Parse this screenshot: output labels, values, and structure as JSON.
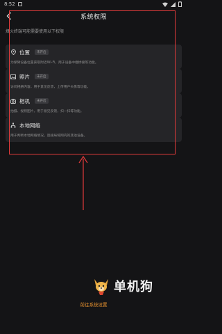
{
  "status_bar": {
    "time": "8:52"
  },
  "header": {
    "title": "系统权限"
  },
  "subtitle": "烽火终端可能需要使用以下权限",
  "permissions": [
    {
      "name": "位置",
      "badge": "未开启",
      "icon": "location-pin-icon",
      "desc": "为保障设备位置获取附近Wi-Fi，用于设备中继桥接等功能。"
    },
    {
      "name": "照片",
      "badge": "未开启",
      "icon": "photo-icon",
      "desc": "访问相册内容，用于意见反馈，上传用户头像等功能。"
    },
    {
      "name": "相机",
      "badge": "未开启",
      "icon": "camera-icon",
      "desc": "拍摄、视频图片，用于意见反馈，扫一扫等功能。"
    },
    {
      "name": "本地网络",
      "badge": "",
      "icon": "local-network-icon",
      "desc": "用于判断本地网络情况，连接局域网内的其他设备。"
    }
  ],
  "logo": {
    "text": "单机狗"
  },
  "footer": {
    "settings_link": "前往系统设置"
  },
  "colors": {
    "background": "#141416",
    "card": "#252528",
    "accent": "#e8922f",
    "annotation": "#e23b3b"
  }
}
